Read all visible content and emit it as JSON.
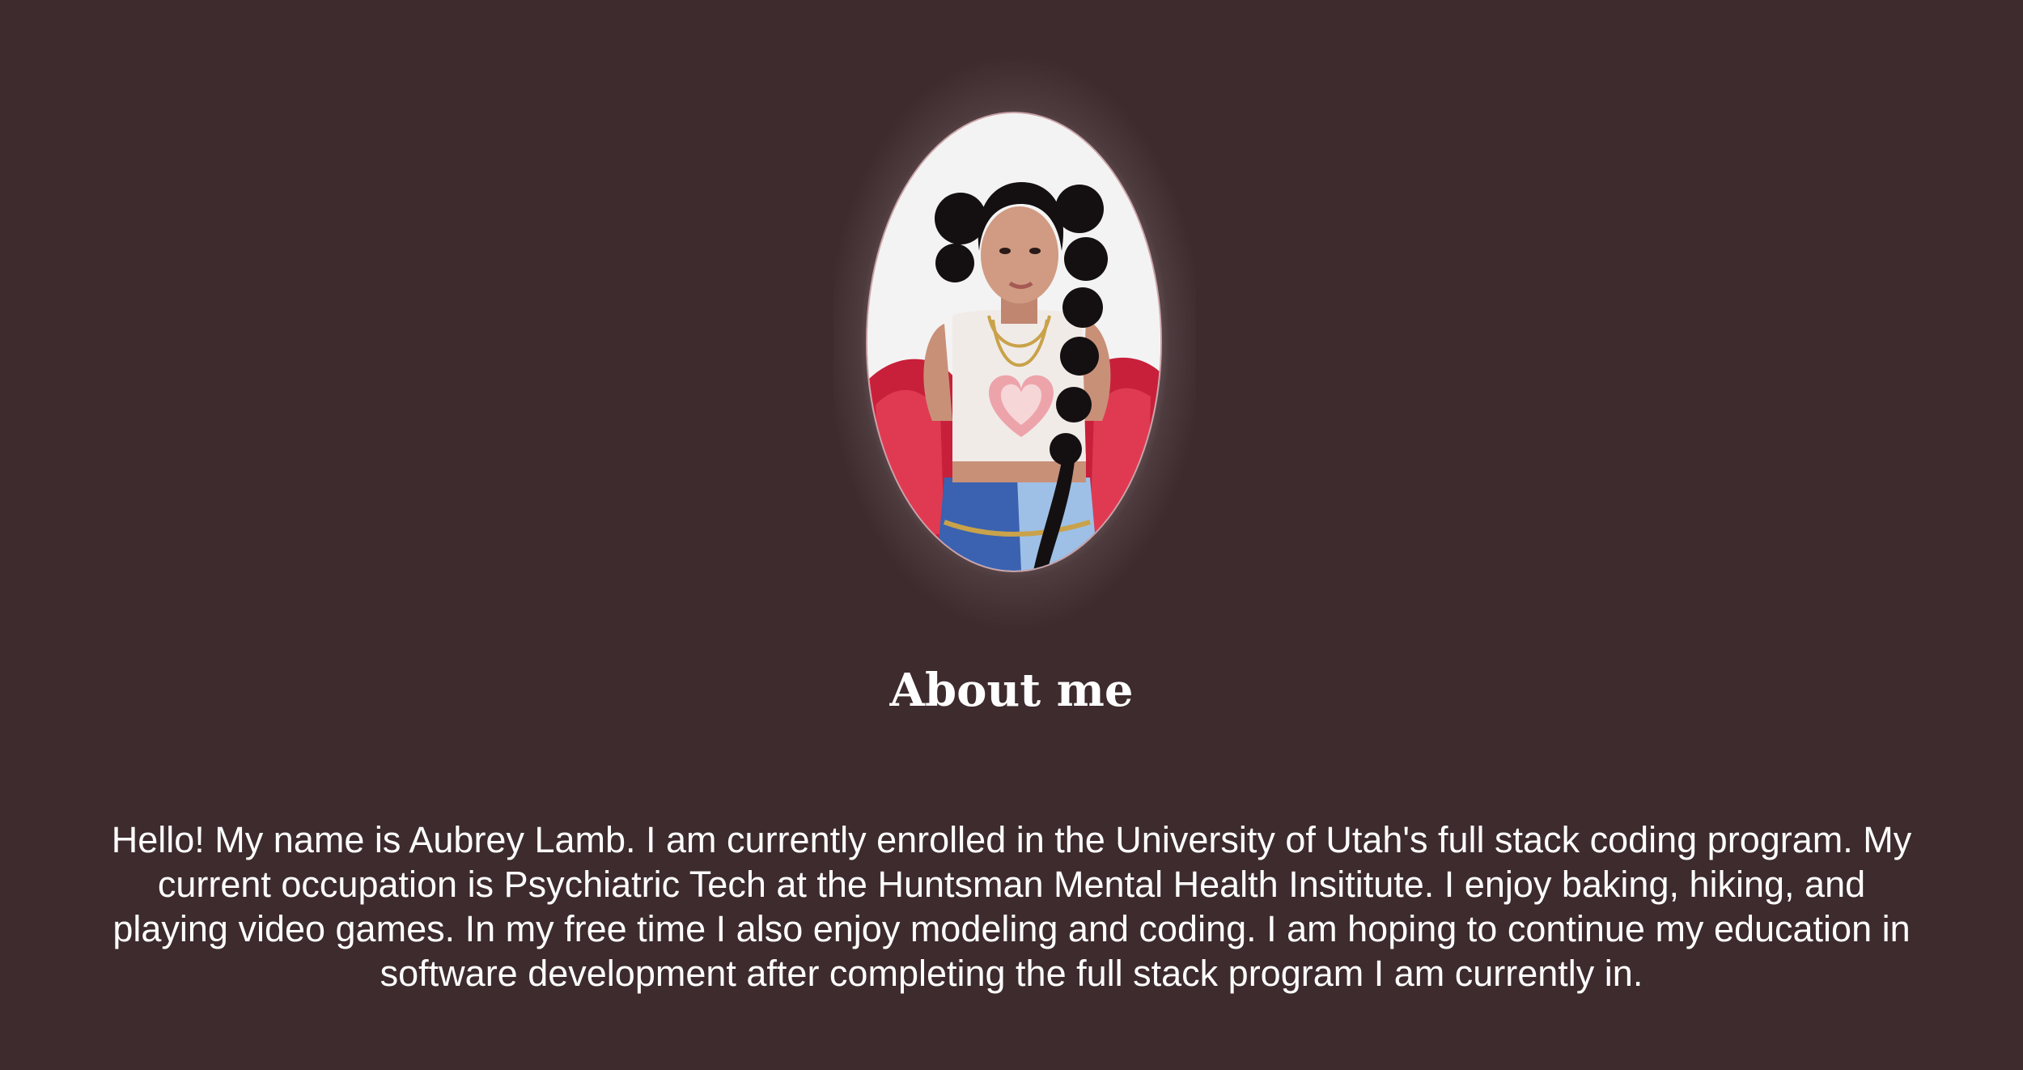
{
  "profile": {
    "photo_icon": "portrait-photo",
    "glow_color": "#ffffff",
    "background_color": "#3d2b2e"
  },
  "about": {
    "heading": "About me",
    "bio": "Hello! My name is Aubrey Lamb. I am currently enrolled in the University of Utah's full stack coding program. My current occupation is Psychiatric Tech at the Huntsman Mental Health Insititute. I enjoy baking, hiking, and playing video games. In my free time I also enjoy modeling and coding. I am hoping to continue my education in software development after completing the full stack program I am currently in."
  }
}
